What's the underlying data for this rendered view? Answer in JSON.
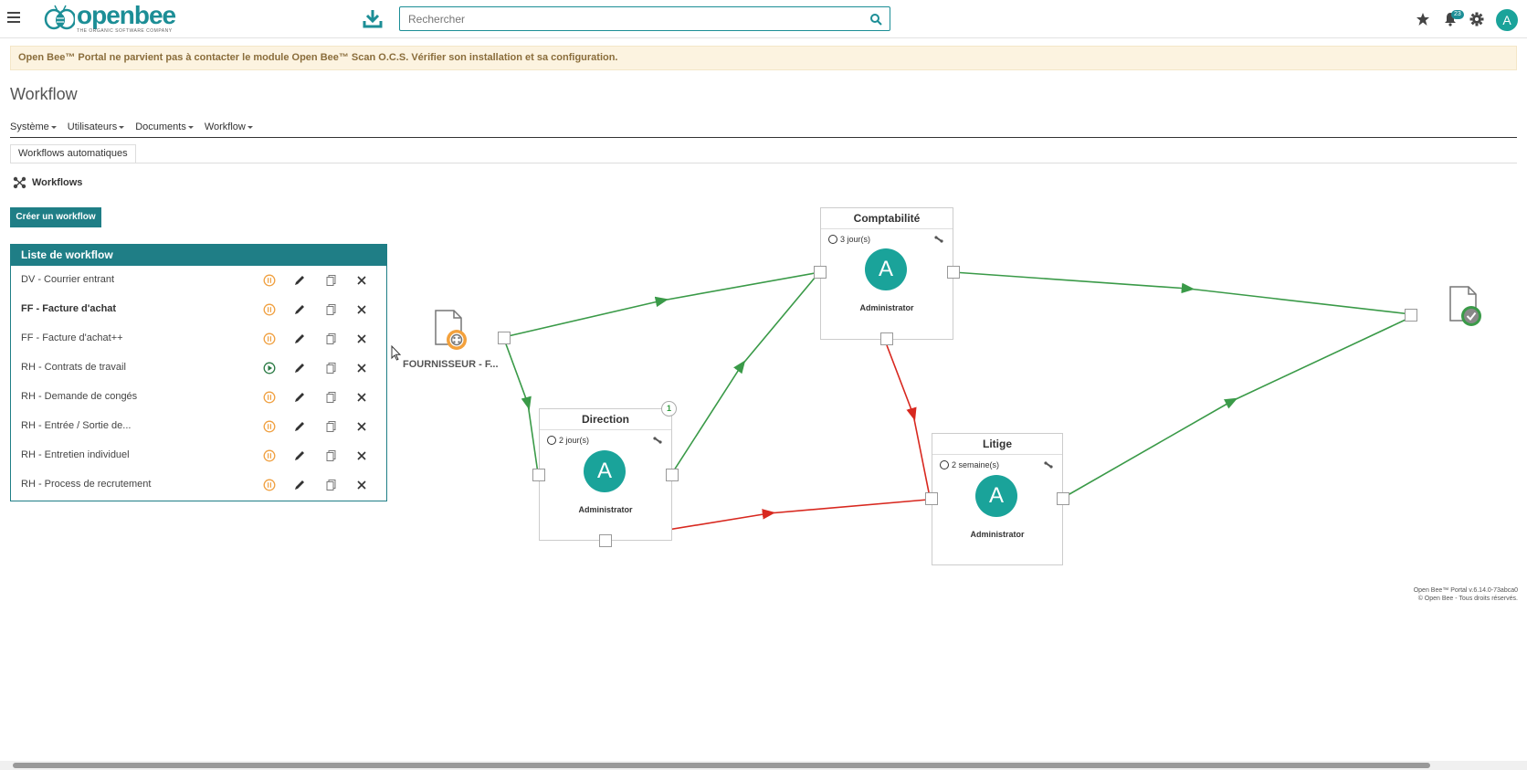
{
  "header": {
    "logo_text": "openbee",
    "logo_tagline": "THE ORGANIC SOFTWARE COMPANY",
    "search_placeholder": "Rechercher",
    "notifications_count": "23",
    "user_initial": "A",
    "accent_color": "#1c8e96"
  },
  "alert": {
    "text": "Open Bee™ Portal ne parvient pas à contacter le module Open Bee™ Scan O.C.S. Vérifier son installation et sa configuration."
  },
  "page": {
    "title": "Workflow"
  },
  "menu": {
    "items": [
      "Système",
      "Utilisateurs",
      "Documents",
      "Workflow"
    ]
  },
  "subtab": {
    "label": "Workflows automatiques"
  },
  "section": {
    "title": "Workflows",
    "create_button": "Créer un workflow"
  },
  "workflow_list": {
    "title": "Liste de workflow",
    "rows": [
      {
        "name": "DV - Courrier entrant",
        "status": "paused",
        "bold": false
      },
      {
        "name": "FF - Facture d'achat",
        "status": "paused",
        "bold": true
      },
      {
        "name": "FF - Facture d'achat++",
        "status": "paused",
        "bold": false
      },
      {
        "name": "RH - Contrats de travail",
        "status": "running",
        "bold": false
      },
      {
        "name": "RH - Demande de congés",
        "status": "paused",
        "bold": false
      },
      {
        "name": "RH - Entrée / Sortie de...",
        "status": "paused",
        "bold": false
      },
      {
        "name": "RH - Entretien individuel",
        "status": "paused",
        "bold": false
      },
      {
        "name": "RH - Process de recrutement",
        "status": "paused",
        "bold": false
      }
    ]
  },
  "diagram": {
    "start_label": "FOURNISSEUR - F...",
    "nodes": {
      "comptabilite": {
        "title": "Comptabilité",
        "duration": "3 jour(s)",
        "initial": "A",
        "user": "Administrator"
      },
      "direction": {
        "title": "Direction",
        "duration": "2 jour(s)",
        "initial": "A",
        "user": "Administrator",
        "badge": "1"
      },
      "litige": {
        "title": "Litige",
        "duration": "2 semaine(s)",
        "initial": "A",
        "user": "Administrator"
      }
    },
    "edge_colors": {
      "accept": "#3a9a48",
      "reject": "#d8281f"
    }
  },
  "footer": {
    "version": "Open Bee™ Portal v.6.14.0-73abca0",
    "copyright": "© Open Bee - Tous droits réservés."
  }
}
